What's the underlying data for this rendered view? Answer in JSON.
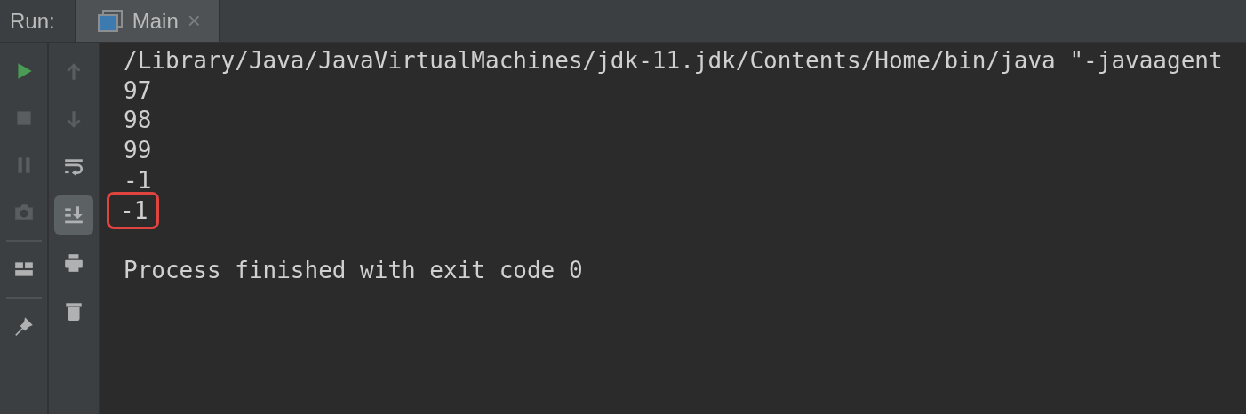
{
  "header": {
    "label": "Run:",
    "tabs": [
      {
        "label": "Main",
        "selected": true,
        "close": "×"
      }
    ]
  },
  "left_toolbar": {
    "groups": [
      [
        {
          "kind": "run",
          "disabled": false
        },
        {
          "kind": "stop",
          "disabled": true
        },
        {
          "kind": "pause",
          "disabled": true
        },
        {
          "kind": "camera",
          "disabled": true
        }
      ],
      [
        {
          "kind": "layout",
          "disabled": false
        }
      ],
      [
        {
          "kind": "pin",
          "disabled": false
        }
      ]
    ]
  },
  "right_toolbar": {
    "buttons": [
      {
        "kind": "up",
        "disabled": true,
        "selected": false
      },
      {
        "kind": "down",
        "disabled": true,
        "selected": false
      },
      {
        "kind": "wrap",
        "disabled": false,
        "selected": false
      },
      {
        "kind": "scroll-end",
        "disabled": false,
        "selected": true
      },
      {
        "kind": "print",
        "disabled": false,
        "selected": false
      },
      {
        "kind": "trash",
        "disabled": false,
        "selected": false
      }
    ]
  },
  "console": {
    "lines": [
      {
        "text": "/Library/Java/JavaVirtualMachines/jdk-11.jdk/Contents/Home/bin/java \"-javaagent",
        "highlighted": false
      },
      {
        "text": "97",
        "highlighted": false
      },
      {
        "text": "98",
        "highlighted": false
      },
      {
        "text": "99",
        "highlighted": false
      },
      {
        "text": "-1",
        "highlighted": false
      },
      {
        "text": "-1",
        "highlighted": true
      }
    ],
    "exit_message": "Process finished with exit code 0"
  }
}
